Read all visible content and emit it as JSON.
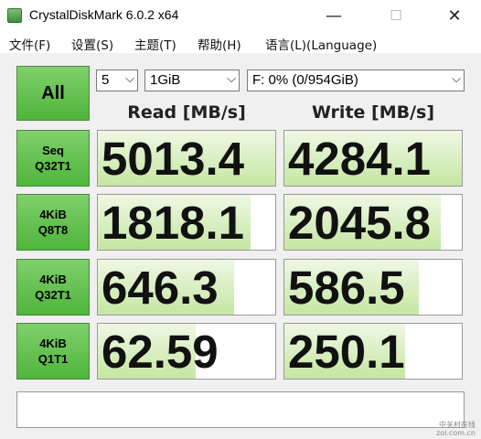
{
  "window": {
    "title": "CrystalDiskMark 6.0.2 x64",
    "minimize": "—",
    "maximize": "☐",
    "close": "✕"
  },
  "menu": {
    "file": "文件(F)",
    "settings": "设置(S)",
    "theme": "主题(T)",
    "help": "帮助(H)",
    "language": "语言(L)(Language)"
  },
  "controls": {
    "all_label": "All",
    "count_value": "5",
    "size_value": "1GiB",
    "drive_value": "F: 0% (0/954GiB)"
  },
  "headers": {
    "read": "Read [MB/s]",
    "write": "Write [MB/s]"
  },
  "rows": [
    {
      "label_line1": "Seq",
      "label_line2": "Q32T1",
      "read": "5013.4",
      "write": "4284.1",
      "read_fill": 1.0,
      "write_fill": 1.0
    },
    {
      "label_line1": "4KiB",
      "label_line2": "Q8T8",
      "read": "1818.1",
      "write": "2045.8",
      "read_fill": 0.86,
      "write_fill": 0.88
    },
    {
      "label_line1": "4KiB",
      "label_line2": "Q32T1",
      "read": "646.3",
      "write": "586.5",
      "read_fill": 0.77,
      "write_fill": 0.76
    },
    {
      "label_line1": "4KiB",
      "label_line2": "Q1T1",
      "read": "62.59",
      "write": "250.1",
      "read_fill": 0.55,
      "write_fill": 0.68
    }
  ],
  "status": {
    "text": ""
  },
  "watermark": {
    "line1": "中关村在线",
    "line2": "zol.com.cn"
  },
  "colors": {
    "accent_green": "#4fb53c",
    "bar_green": "#c5e6a3"
  }
}
